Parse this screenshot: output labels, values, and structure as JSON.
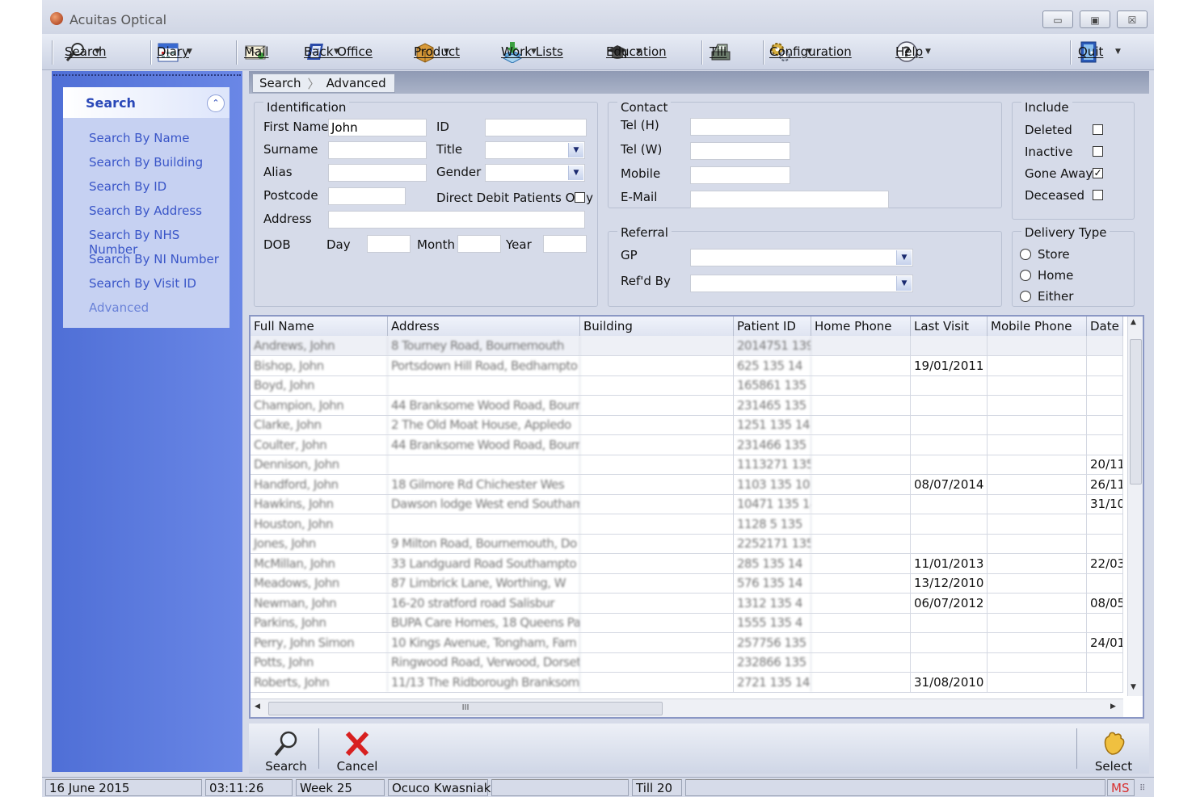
{
  "window": {
    "title": "Acuitas Optical",
    "minimize": "▭",
    "maximize": "▣",
    "close": "☒"
  },
  "toolbar": {
    "items": [
      {
        "label": "Search",
        "icon": "search-icon",
        "dropdown": true
      },
      {
        "label": "Diary",
        "icon": "calendar-icon",
        "dropdown": true
      },
      {
        "label": "Mail",
        "icon": "mail-icon",
        "dropdown": false
      },
      {
        "label": "Back Office",
        "icon": "back-office-icon",
        "dropdown": true
      },
      {
        "label": "Product",
        "icon": "product-box-icon",
        "dropdown": true
      },
      {
        "label": "Work Lists",
        "icon": "work-list-icon",
        "dropdown": true
      },
      {
        "label": "Education",
        "icon": "graduation-cap-icon",
        "dropdown": true
      },
      {
        "label": "Till",
        "icon": "till-icon",
        "dropdown": false
      },
      {
        "label": "Configuration",
        "icon": "gears-icon",
        "dropdown": true
      },
      {
        "label": "Help",
        "icon": "help-icon",
        "dropdown": true
      },
      {
        "label": "Quit",
        "icon": "exit-door-icon",
        "dropdown": true
      }
    ]
  },
  "sidebar": {
    "panel_title": "Search",
    "collapse_glyph": "⌃",
    "items": [
      "Search By Name",
      "Search By Building",
      "Search By ID",
      "Search By Address",
      "Search By NHS Number",
      "Search By NI Number",
      "Search By Visit ID",
      "Advanced"
    ]
  },
  "breadcrumb": {
    "items": [
      "Search",
      "Advanced"
    ],
    "separator": "〉"
  },
  "identification": {
    "group_label": "Identification",
    "first_name_label": "First Name",
    "first_name_value": "John",
    "surname_label": "Surname",
    "alias_label": "Alias",
    "postcode_label": "Postcode",
    "address_label": "Address",
    "dob_label": "DOB",
    "day_label": "Day",
    "month_label": "Month",
    "year_label": "Year",
    "id_label": "ID",
    "title_label": "Title",
    "gender_label": "Gender",
    "direct_debit_label": "Direct Debit Patients Only"
  },
  "contact": {
    "group_label": "Contact",
    "tel_h_label": "Tel (H)",
    "tel_w_label": "Tel (W)",
    "mobile_label": "Mobile",
    "email_label": "E-Mail"
  },
  "referral": {
    "group_label": "Referral",
    "gp_label": "GP",
    "refd_by_label": "Ref'd By"
  },
  "include": {
    "group_label": "Include",
    "options": [
      {
        "label": "Deleted",
        "checked": false
      },
      {
        "label": "Inactive",
        "checked": false
      },
      {
        "label": "Gone Away",
        "checked": true
      },
      {
        "label": "Deceased",
        "checked": false
      }
    ]
  },
  "delivery": {
    "group_label": "Delivery Type",
    "options": [
      "Store",
      "Home",
      "Either"
    ]
  },
  "grid": {
    "columns": [
      "Full Name",
      "Address",
      "Building",
      "Patient ID",
      "Home Phone",
      "Last Visit",
      "Mobile Phone",
      "Date C"
    ],
    "rows": [
      {
        "name": "Andrews, John",
        "address": "8 Tourney Road, Bournemouth",
        "pid": "2014751 139",
        "last_visit": "",
        "date": ""
      },
      {
        "name": "Bishop, John",
        "address": "Portsdown Hill Road, Bedhampto",
        "pid": "625 135 14",
        "last_visit": "19/01/2011",
        "date": ""
      },
      {
        "name": "Boyd, John",
        "address": "",
        "pid": "165861 135",
        "last_visit": "",
        "date": ""
      },
      {
        "name": "Champion, John",
        "address": "44 Branksome Wood Road, Bourne",
        "pid": "231465 135",
        "last_visit": "",
        "date": ""
      },
      {
        "name": "Clarke, John",
        "address": "2 The Old Moat House, Appledo",
        "pid": "1251 135 14",
        "last_visit": "",
        "date": ""
      },
      {
        "name": "Coulter, John",
        "address": "44 Branksome Wood Road, Bourne",
        "pid": "231466 135",
        "last_visit": "",
        "date": ""
      },
      {
        "name": "Dennison, John",
        "address": "",
        "pid": "1113271 135",
        "last_visit": "",
        "date": "20/11/"
      },
      {
        "name": "Handford, John",
        "address": "18 Gilmore Rd Chichester Wes",
        "pid": "1103 135 106",
        "last_visit": "08/07/2014",
        "date": "26/11/"
      },
      {
        "name": "Hawkins, John",
        "address": "Dawson lodge West end Southamp",
        "pid": "10471 135 14",
        "last_visit": "",
        "date": "31/10/"
      },
      {
        "name": "Houston, John",
        "address": "",
        "pid": "1128 5 135",
        "last_visit": "",
        "date": ""
      },
      {
        "name": "Jones, John",
        "address": "9 Milton Road, Bournemouth, Do",
        "pid": "2252171 135",
        "last_visit": "",
        "date": ""
      },
      {
        "name": "McMillan, John",
        "address": "33 Landguard Road Southampto",
        "pid": "285 135 14",
        "last_visit": "11/01/2013",
        "date": "22/03/"
      },
      {
        "name": "Meadows, John",
        "address": "87 Limbrick Lane, Worthing, W",
        "pid": "576 135 14",
        "last_visit": "13/12/2010",
        "date": ""
      },
      {
        "name": "Newman, John",
        "address": "16-20 stratford road Salisbur",
        "pid": "1312 135 4",
        "last_visit": "06/07/2012",
        "date": "08/05/"
      },
      {
        "name": "Parkins, John",
        "address": "BUPA Care Homes, 18 Queens Par",
        "pid": "1555 135 4",
        "last_visit": "",
        "date": ""
      },
      {
        "name": "Perry, John Simon",
        "address": "10 Kings Avenue, Tongham, Farn",
        "pid": "257756 135",
        "last_visit": "",
        "date": "24/01/"
      },
      {
        "name": "Potts, John",
        "address": "Ringwood Road, Verwood, Dorset",
        "pid": "232866 135",
        "last_visit": "",
        "date": ""
      },
      {
        "name": "Roberts, John",
        "address": "11/13 The Ridborough Branksom",
        "pid": "2721 135 14",
        "last_visit": "31/08/2010",
        "date": ""
      }
    ],
    "hscroll_grip": "III",
    "scroll_up": "▲",
    "scroll_down": "▼",
    "scroll_left": "◀",
    "scroll_right": "▶"
  },
  "bottom": {
    "search": "Search",
    "cancel": "Cancel",
    "select": "Select"
  },
  "status": {
    "date": "16 June 2015",
    "time": "03:11:26",
    "week": "Week 25",
    "user": "Ocuco Kwasniak",
    "blank": "",
    "till": "Till 20",
    "ms": "MS"
  }
}
